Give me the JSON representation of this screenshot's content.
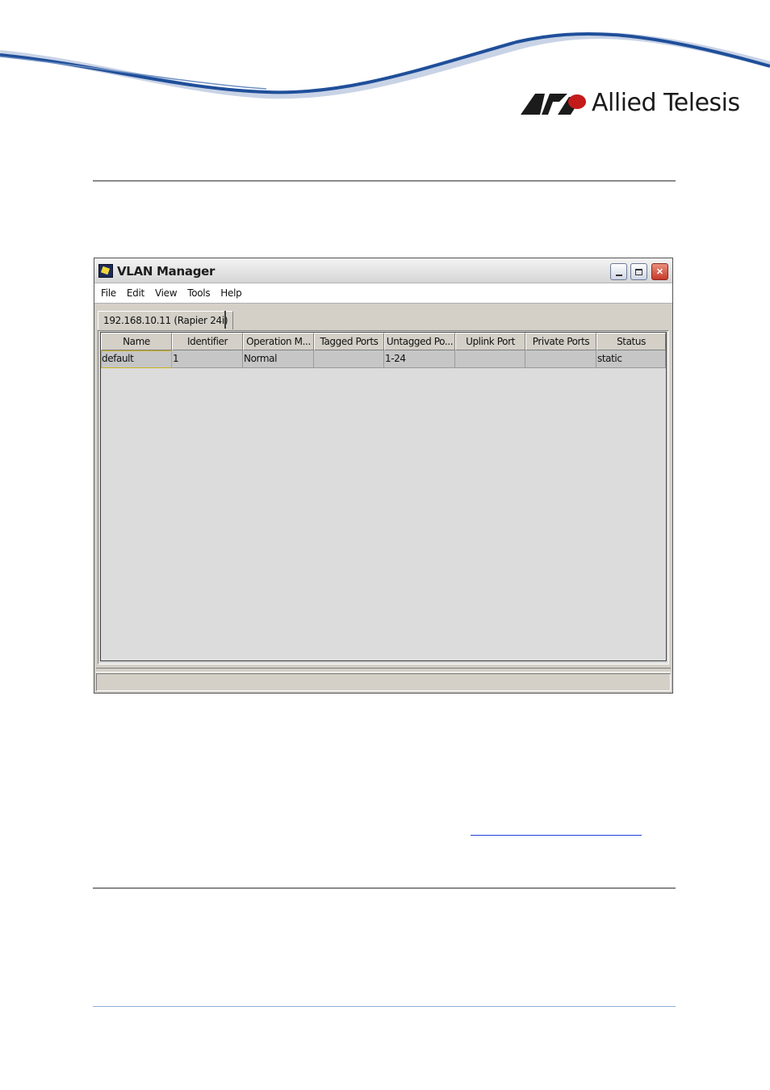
{
  "brand": {
    "logo_text": "Allied Telesis",
    "accent": "#c41a1a"
  },
  "window": {
    "title": "VLAN Manager",
    "menu": [
      "File",
      "Edit",
      "View",
      "Tools",
      "Help"
    ],
    "tab_label": "192.168.10.11 (Rapier 24i)",
    "table": {
      "columns": [
        "Name",
        "Identifier",
        "Operation M...",
        "Tagged Ports",
        "Untagged Po...",
        "Uplink Port",
        "Private Ports",
        "Status"
      ],
      "rows": [
        [
          "default",
          "1",
          "Normal",
          "",
          "1-24",
          "",
          "",
          "static"
        ]
      ]
    }
  }
}
